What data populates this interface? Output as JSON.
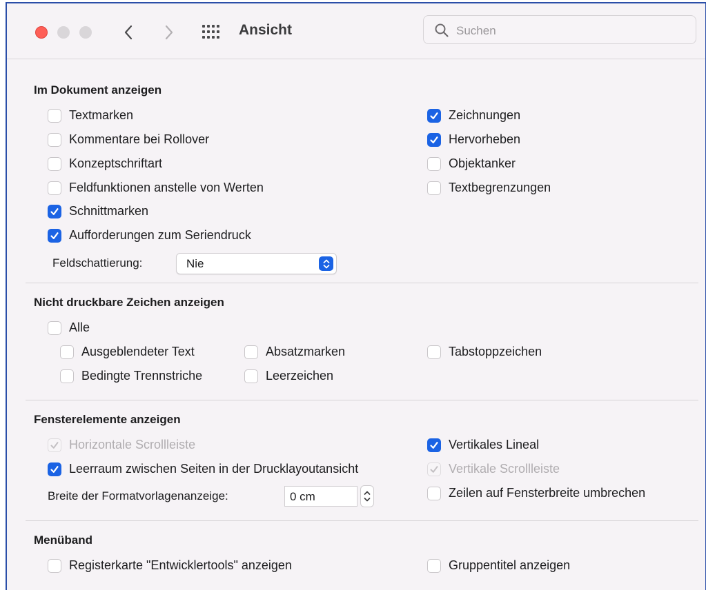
{
  "toolbar": {
    "title": "Ansicht",
    "search_placeholder": "Suchen",
    "icons": [
      "close-traffic-light",
      "minimize-traffic-light",
      "zoom-traffic-light",
      "chevron-left-icon",
      "chevron-right-icon",
      "grid-icon",
      "search-icon"
    ]
  },
  "sections": {
    "document": {
      "title": "Im Dokument anzeigen",
      "left": [
        {
          "label": "Textmarken",
          "checked": false
        },
        {
          "label": "Kommentare bei Rollover",
          "checked": false
        },
        {
          "label": "Konzeptschriftart",
          "checked": false
        },
        {
          "label": "Feldfunktionen anstelle von Werten",
          "checked": false
        },
        {
          "label": "Schnittmarken",
          "checked": true
        },
        {
          "label": "Aufforderungen zum Seriendruck",
          "checked": true
        }
      ],
      "right": [
        {
          "label": "Zeichnungen",
          "checked": true
        },
        {
          "label": "Hervorheben",
          "checked": true
        },
        {
          "label": "Objektanker",
          "checked": false
        },
        {
          "label": "Textbegrenzungen",
          "checked": false
        }
      ],
      "shading_label": "Feldschattierung:",
      "shading_value": "Nie"
    },
    "nonprint": {
      "title": "Nicht druckbare Zeichen anzeigen",
      "all": {
        "label": "Alle",
        "checked": false
      },
      "items": [
        {
          "label": "Ausgeblendeter Text",
          "checked": false
        },
        {
          "label": "Absatzmarken",
          "checked": false
        },
        {
          "label": "Tabstoppzeichen",
          "checked": false
        },
        {
          "label": "Bedingte Trennstriche",
          "checked": false
        },
        {
          "label": "Leerzeichen",
          "checked": false
        }
      ]
    },
    "window": {
      "title": "Fensterelemente anzeigen",
      "left": [
        {
          "label": "Horizontale Scrollleiste",
          "checked": true,
          "disabled": true
        },
        {
          "label": "Leerraum zwischen Seiten in der Drucklayoutansicht",
          "checked": true,
          "disabled": false
        }
      ],
      "right": [
        {
          "label": "Vertikales Lineal",
          "checked": true,
          "disabled": false
        },
        {
          "label": "Vertikale Scrollleiste",
          "checked": true,
          "disabled": true
        },
        {
          "label": "Zeilen auf Fensterbreite umbrechen",
          "checked": false,
          "disabled": false
        }
      ],
      "style_width_label": "Breite der Formatvorlagenanzeige:",
      "style_width_value": "0 cm"
    },
    "ribbon": {
      "title": "Menüband",
      "left": [
        {
          "label": "Registerkarte \"Entwicklertools\" anzeigen",
          "checked": false
        }
      ],
      "right": [
        {
          "label": "Gruppentitel anzeigen",
          "checked": false
        }
      ]
    }
  },
  "colors": {
    "accent": "#1b63e4",
    "window_bg": "#f6f3f6",
    "border": "#2a4ea8"
  }
}
